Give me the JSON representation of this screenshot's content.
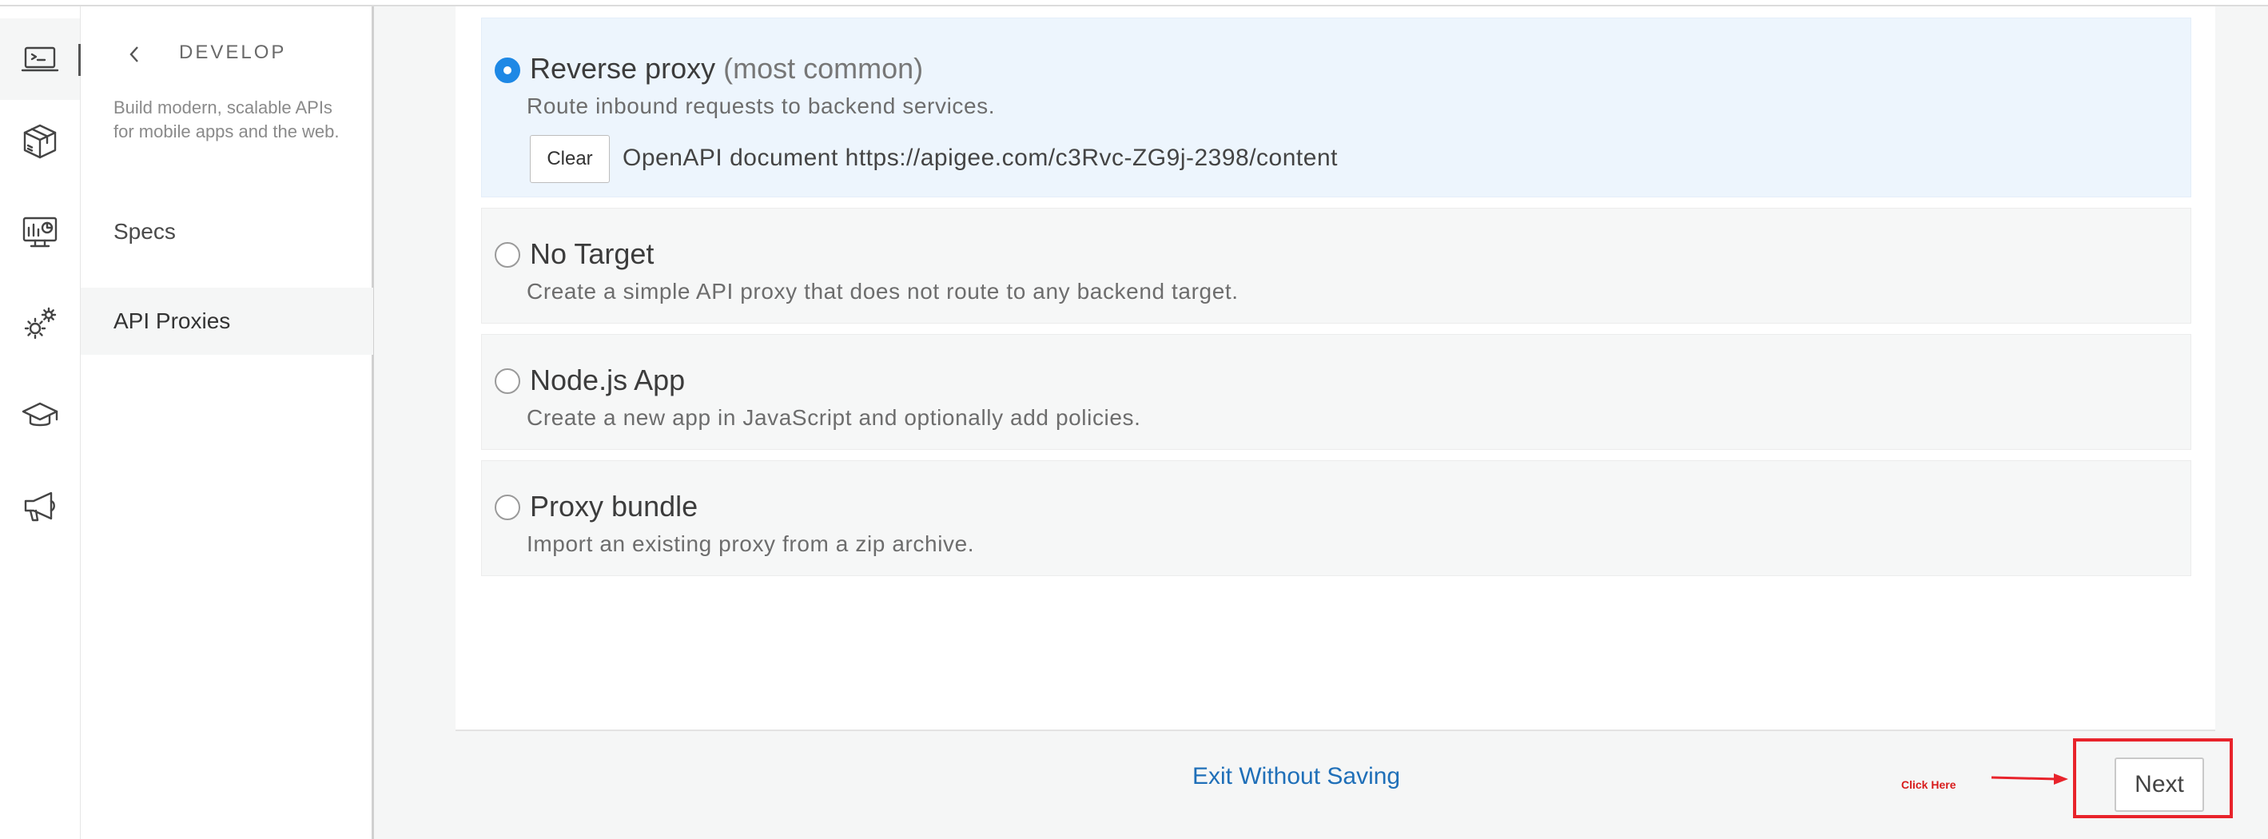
{
  "rail": {
    "items": [
      {
        "icon": "terminal-icon",
        "active": true
      },
      {
        "icon": "package-icon",
        "active": false
      },
      {
        "icon": "monitor-analytics-icon",
        "active": false
      },
      {
        "icon": "gears-icon",
        "active": false
      },
      {
        "icon": "graduation-cap-icon",
        "active": false
      },
      {
        "icon": "megaphone-icon",
        "active": false
      }
    ]
  },
  "subnav": {
    "back_icon": "chevron-left-icon",
    "title": "DEVELOP",
    "description": "Build modern, scalable APIs for mobile apps and the web.",
    "items": [
      {
        "label": "Specs",
        "active": false
      },
      {
        "label": "API Proxies",
        "active": true
      }
    ]
  },
  "options": [
    {
      "title": "Reverse proxy",
      "title_suffix": "(most common)",
      "description": "Route inbound requests to backend services.",
      "selected": true,
      "clear_label": "Clear",
      "openapi_text": "OpenAPI document https://apigee.com/c3Rvc-ZG9j-2398/content"
    },
    {
      "title": "No Target",
      "description": "Create a simple API proxy that does not route to any backend target.",
      "selected": false
    },
    {
      "title": "Node.js App",
      "description": "Create a new app in JavaScript and optionally add policies.",
      "selected": false
    },
    {
      "title": "Proxy bundle",
      "description": "Import an existing proxy from a zip archive.",
      "selected": false
    }
  ],
  "footer": {
    "exit_label": "Exit Without Saving",
    "next_label": "Next",
    "annotation_text": "Click Here"
  },
  "colors": {
    "accent": "#1e88e5",
    "link": "#1f6fb8",
    "annotation": "#e8232b"
  }
}
